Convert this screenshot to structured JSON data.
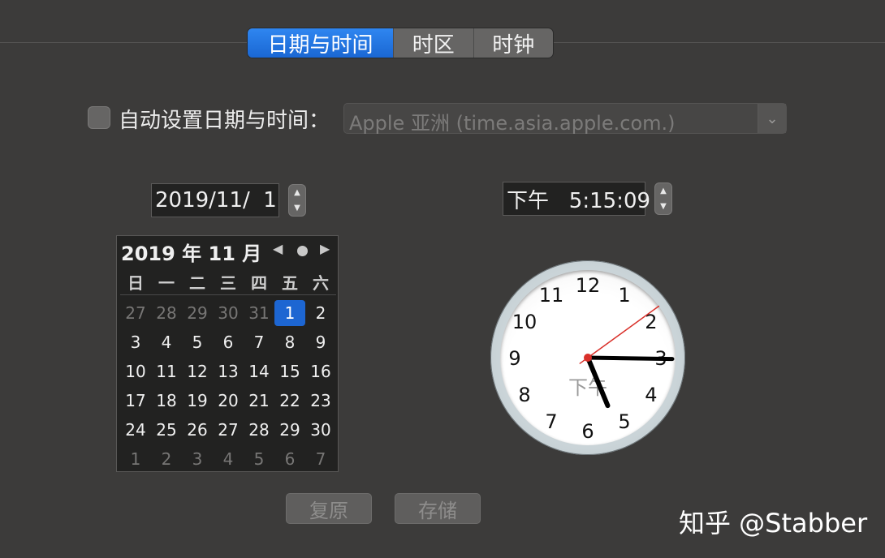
{
  "tabs": [
    {
      "label": "日期与时间",
      "active": true
    },
    {
      "label": "时区",
      "active": false
    },
    {
      "label": "时钟",
      "active": false
    }
  ],
  "auto_set": {
    "label": "自动设置日期与时间：",
    "checked": false,
    "server": "Apple 亚洲 (time.asia.apple.com.)"
  },
  "date_field": {
    "value": "2019/11/  1"
  },
  "time_field": {
    "value": "下午   5:15:09"
  },
  "calendar": {
    "title": "2019 年 11 月",
    "weekdays": [
      "日",
      "一",
      "二",
      "三",
      "四",
      "五",
      "六"
    ],
    "weeks": [
      [
        "27",
        "28",
        "29",
        "30",
        "31",
        "1",
        "2"
      ],
      [
        "3",
        "4",
        "5",
        "6",
        "7",
        "8",
        "9"
      ],
      [
        "10",
        "11",
        "12",
        "13",
        "14",
        "15",
        "16"
      ],
      [
        "17",
        "18",
        "19",
        "20",
        "21",
        "22",
        "23"
      ],
      [
        "24",
        "25",
        "26",
        "27",
        "28",
        "29",
        "30"
      ],
      [
        "1",
        "2",
        "3",
        "4",
        "5",
        "6",
        "7"
      ]
    ],
    "dim": [
      [
        0,
        0
      ],
      [
        0,
        1
      ],
      [
        0,
        2
      ],
      [
        0,
        3
      ],
      [
        0,
        4
      ],
      [
        5,
        0
      ],
      [
        5,
        1
      ],
      [
        5,
        2
      ],
      [
        5,
        3
      ],
      [
        5,
        4
      ],
      [
        5,
        5
      ],
      [
        5,
        6
      ]
    ],
    "selected": [
      0,
      5
    ]
  },
  "clock": {
    "numbers": [
      "12",
      "1",
      "2",
      "3",
      "4",
      "5",
      "6",
      "7",
      "8",
      "9",
      "10",
      "11"
    ],
    "period_label": "下午",
    "hour": 5,
    "minute": 15,
    "second": 9,
    "second_hand_color": "#d9302a"
  },
  "buttons": {
    "revert": "复原",
    "save": "存储"
  },
  "watermark": "知乎 @Stabber",
  "colors": {
    "accent": "#1d66d2",
    "background": "#3c3b3a"
  }
}
